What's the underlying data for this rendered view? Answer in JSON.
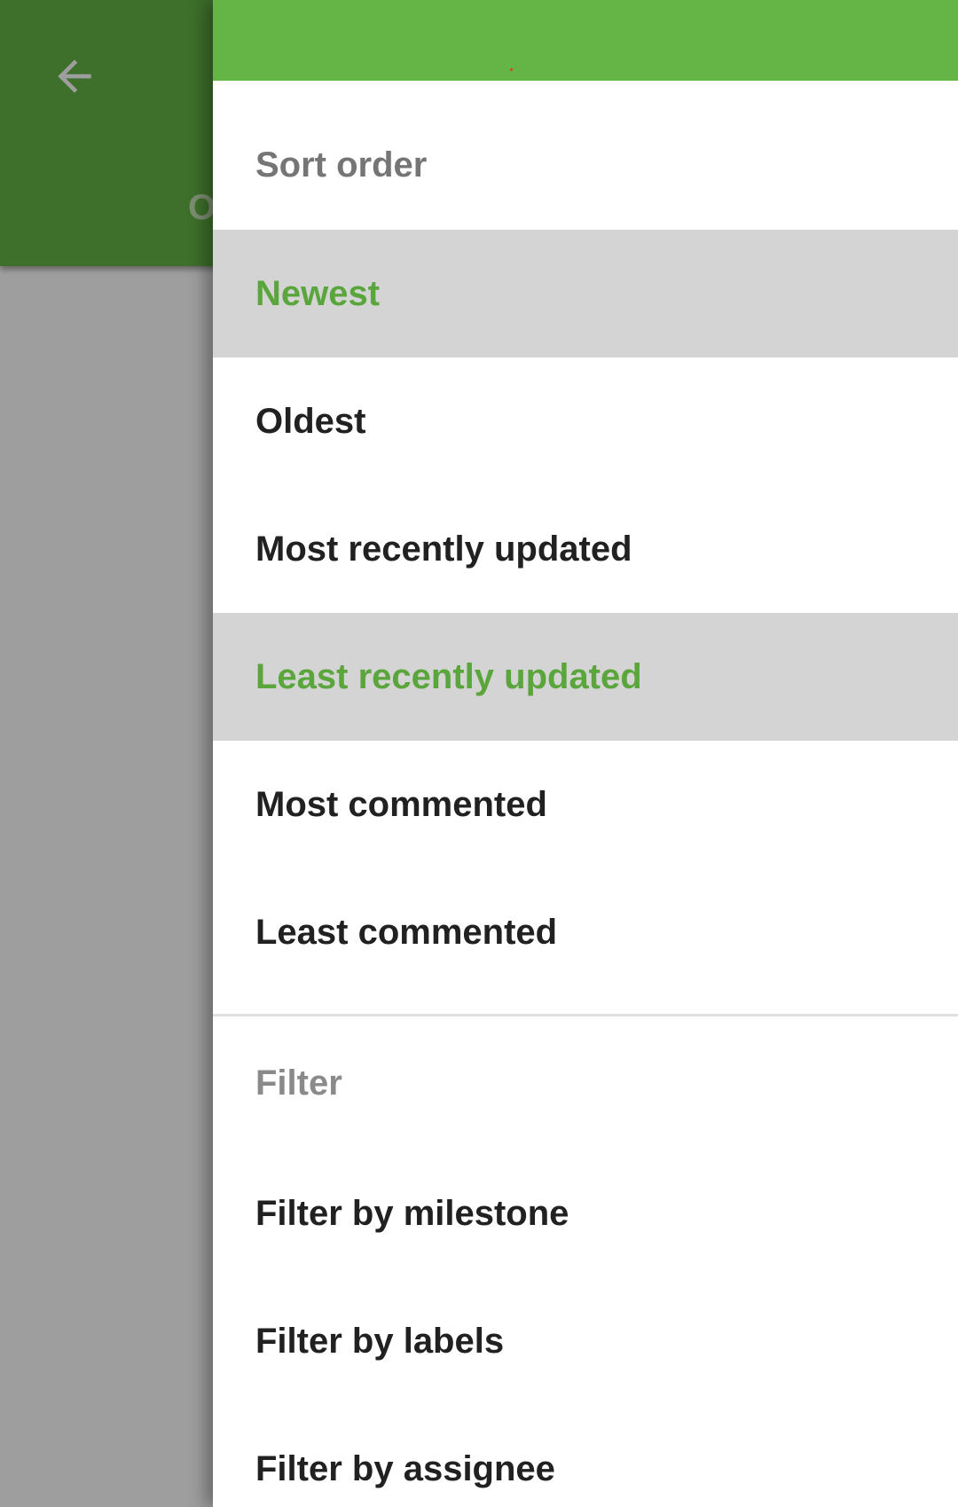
{
  "background": {
    "tab_label": "O",
    "back_icon": "arrow-left-icon"
  },
  "drawer": {
    "sort_header": "Sort order",
    "sort_options": [
      {
        "label": "Newest",
        "selected": true
      },
      {
        "label": "Oldest",
        "selected": false
      },
      {
        "label": "Most recently updated",
        "selected": false
      },
      {
        "label": "Least recently updated",
        "selected": true
      },
      {
        "label": "Most commented",
        "selected": false
      },
      {
        "label": "Least commented",
        "selected": false
      }
    ],
    "filter_header": "Filter",
    "filter_options": [
      {
        "label": "Filter by milestone"
      },
      {
        "label": "Filter by labels"
      },
      {
        "label": "Filter by assignee"
      }
    ]
  },
  "colors": {
    "primary": "#64b446",
    "accent_text": "#5aa63c",
    "selected_bg": "#d4d4d4"
  }
}
